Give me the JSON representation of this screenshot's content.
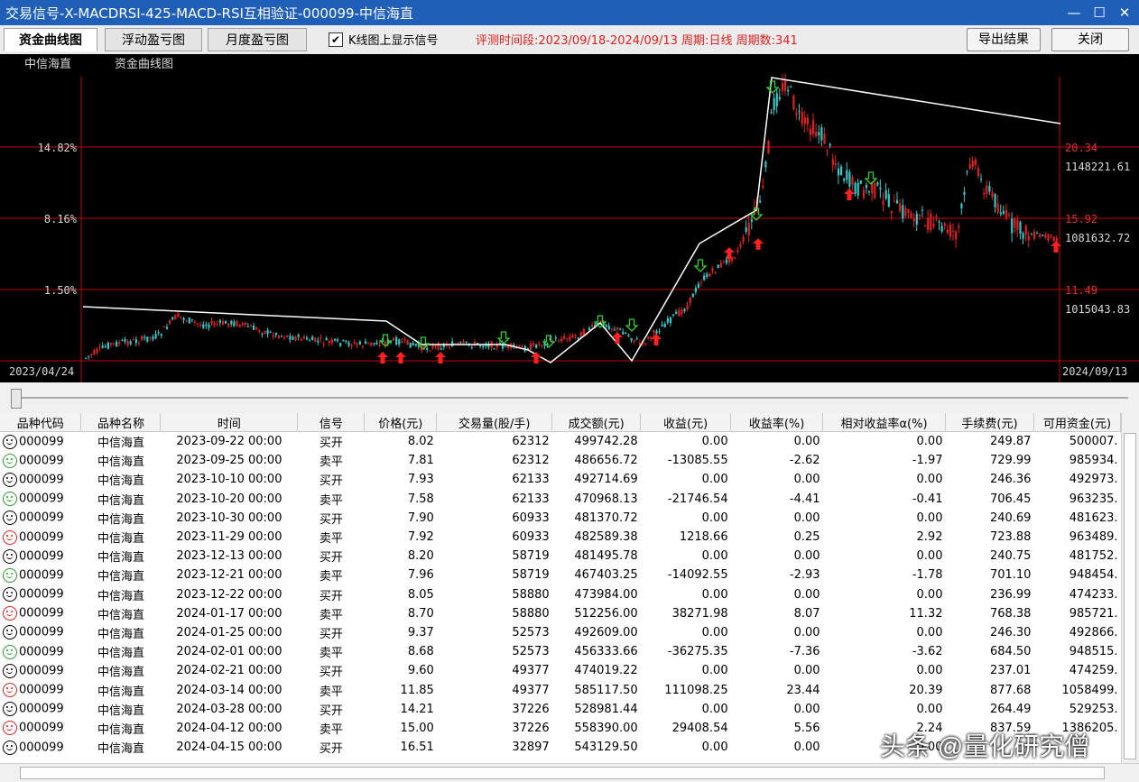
{
  "window": {
    "title": "交易信号-X-MACDRSI-425-MACD-RSI互相验证-000099-中信海直",
    "min": "—",
    "max": "☐",
    "close": "✕"
  },
  "toolbar": {
    "tabs": [
      "资金曲线图",
      "浮动盈亏图",
      "月度盈亏图"
    ],
    "show_signal_label": "K线图上显示信号",
    "eval_info": "评测时间段:2023/09/18-2024/09/13 周期:日线 周期数:341",
    "export_label": "导出结果",
    "close_label": "关闭"
  },
  "chart": {
    "stock_name": "中信海直",
    "curve_label": "资金曲线图",
    "left_ticks": [
      "14.82%",
      "8.16%",
      "1.50%"
    ],
    "right_price_ticks": [
      "20.34",
      "15.92",
      "11.49"
    ],
    "right_value_ticks": [
      "1148221.61",
      "1081632.72",
      "1015043.83"
    ],
    "start_date": "2023/04/24",
    "end_date": "2024/09/13",
    "colors": {
      "bg": "#000000",
      "grid": "#c00000",
      "up": "#e02020",
      "down": "#30c8c8",
      "equity": "#ffffff",
      "buy": "#ff2020",
      "sell": "#30d030"
    }
  },
  "table": {
    "headers": [
      "品种代码",
      "品种名称",
      "时间",
      "信号",
      "价格(元)",
      "交易量(股/手)",
      "成交额(元)",
      "收益(元)",
      "收益率(%)",
      "相对收益率α(%)",
      "手续费(元)",
      "可用资金(元)"
    ],
    "rows": [
      {
        "icon": "black",
        "code": "000099",
        "name": "中信海直",
        "time": "2023-09-22 00:00",
        "signal": "买开",
        "price": "8.02",
        "qty": "62312",
        "amount": "499742.28",
        "profit": "0.00",
        "rate": "0.00",
        "alpha": "0.00",
        "fee": "249.87",
        "cash": "500007."
      },
      {
        "icon": "green",
        "code": "000099",
        "name": "中信海直",
        "time": "2023-09-25 00:00",
        "signal": "卖平",
        "price": "7.81",
        "qty": "62312",
        "amount": "486656.72",
        "profit": "-13085.55",
        "rate": "-2.62",
        "alpha": "-1.97",
        "fee": "729.99",
        "cash": "985934."
      },
      {
        "icon": "black",
        "code": "000099",
        "name": "中信海直",
        "time": "2023-10-10 00:00",
        "signal": "买开",
        "price": "7.93",
        "qty": "62133",
        "amount": "492714.69",
        "profit": "0.00",
        "rate": "0.00",
        "alpha": "0.00",
        "fee": "246.36",
        "cash": "492973."
      },
      {
        "icon": "green",
        "code": "000099",
        "name": "中信海直",
        "time": "2023-10-20 00:00",
        "signal": "卖平",
        "price": "7.58",
        "qty": "62133",
        "amount": "470968.13",
        "profit": "-21746.54",
        "rate": "-4.41",
        "alpha": "-0.41",
        "fee": "706.45",
        "cash": "963235."
      },
      {
        "icon": "black",
        "code": "000099",
        "name": "中信海直",
        "time": "2023-10-30 00:00",
        "signal": "买开",
        "price": "7.90",
        "qty": "60933",
        "amount": "481370.72",
        "profit": "0.00",
        "rate": "0.00",
        "alpha": "0.00",
        "fee": "240.69",
        "cash": "481623."
      },
      {
        "icon": "red",
        "code": "000099",
        "name": "中信海直",
        "time": "2023-11-29 00:00",
        "signal": "卖平",
        "price": "7.92",
        "qty": "60933",
        "amount": "482589.38",
        "profit": "1218.66",
        "rate": "0.25",
        "alpha": "2.92",
        "fee": "723.88",
        "cash": "963489."
      },
      {
        "icon": "black",
        "code": "000099",
        "name": "中信海直",
        "time": "2023-12-13 00:00",
        "signal": "买开",
        "price": "8.20",
        "qty": "58719",
        "amount": "481495.78",
        "profit": "0.00",
        "rate": "0.00",
        "alpha": "0.00",
        "fee": "240.75",
        "cash": "481752."
      },
      {
        "icon": "green",
        "code": "000099",
        "name": "中信海直",
        "time": "2023-12-21 00:00",
        "signal": "卖平",
        "price": "7.96",
        "qty": "58719",
        "amount": "467403.25",
        "profit": "-14092.55",
        "rate": "-2.93",
        "alpha": "-1.78",
        "fee": "701.10",
        "cash": "948454."
      },
      {
        "icon": "black",
        "code": "000099",
        "name": "中信海直",
        "time": "2023-12-22 00:00",
        "signal": "买开",
        "price": "8.05",
        "qty": "58880",
        "amount": "473984.00",
        "profit": "0.00",
        "rate": "0.00",
        "alpha": "0.00",
        "fee": "236.99",
        "cash": "474233."
      },
      {
        "icon": "red",
        "code": "000099",
        "name": "中信海直",
        "time": "2024-01-17 00:00",
        "signal": "卖平",
        "price": "8.70",
        "qty": "58880",
        "amount": "512256.00",
        "profit": "38271.98",
        "rate": "8.07",
        "alpha": "11.32",
        "fee": "768.38",
        "cash": "985721."
      },
      {
        "icon": "black",
        "code": "000099",
        "name": "中信海直",
        "time": "2024-01-25 00:00",
        "signal": "买开",
        "price": "9.37",
        "qty": "52573",
        "amount": "492609.00",
        "profit": "0.00",
        "rate": "0.00",
        "alpha": "0.00",
        "fee": "246.30",
        "cash": "492866."
      },
      {
        "icon": "green",
        "code": "000099",
        "name": "中信海直",
        "time": "2024-02-01 00:00",
        "signal": "卖平",
        "price": "8.68",
        "qty": "52573",
        "amount": "456333.66",
        "profit": "-36275.35",
        "rate": "-7.36",
        "alpha": "-3.62",
        "fee": "684.50",
        "cash": "948515."
      },
      {
        "icon": "black",
        "code": "000099",
        "name": "中信海直",
        "time": "2024-02-21 00:00",
        "signal": "买开",
        "price": "9.60",
        "qty": "49377",
        "amount": "474019.22",
        "profit": "0.00",
        "rate": "0.00",
        "alpha": "0.00",
        "fee": "237.01",
        "cash": "474259."
      },
      {
        "icon": "red",
        "code": "000099",
        "name": "中信海直",
        "time": "2024-03-14 00:00",
        "signal": "卖平",
        "price": "11.85",
        "qty": "49377",
        "amount": "585117.50",
        "profit": "111098.25",
        "rate": "23.44",
        "alpha": "20.39",
        "fee": "877.68",
        "cash": "1058499."
      },
      {
        "icon": "black",
        "code": "000099",
        "name": "中信海直",
        "time": "2024-03-28 00:00",
        "signal": "买开",
        "price": "14.21",
        "qty": "37226",
        "amount": "528981.44",
        "profit": "0.00",
        "rate": "0.00",
        "alpha": "0.00",
        "fee": "264.49",
        "cash": "529253."
      },
      {
        "icon": "red",
        "code": "000099",
        "name": "中信海直",
        "time": "2024-04-12 00:00",
        "signal": "卖平",
        "price": "15.00",
        "qty": "37226",
        "amount": "558390.00",
        "profit": "29408.54",
        "rate": "5.56",
        "alpha": "2.24",
        "fee": "837.59",
        "cash": "1386205."
      },
      {
        "icon": "black",
        "code": "000099",
        "name": "中信海直",
        "time": "2024-04-15 00:00",
        "signal": "买开",
        "price": "16.51",
        "qty": "32897",
        "amount": "543129.50",
        "profit": "0.00",
        "rate": "0.00",
        "alpha": "0.00",
        "fee": "",
        "cash": ""
      }
    ]
  },
  "watermark": "头条 @量化研究僧"
}
